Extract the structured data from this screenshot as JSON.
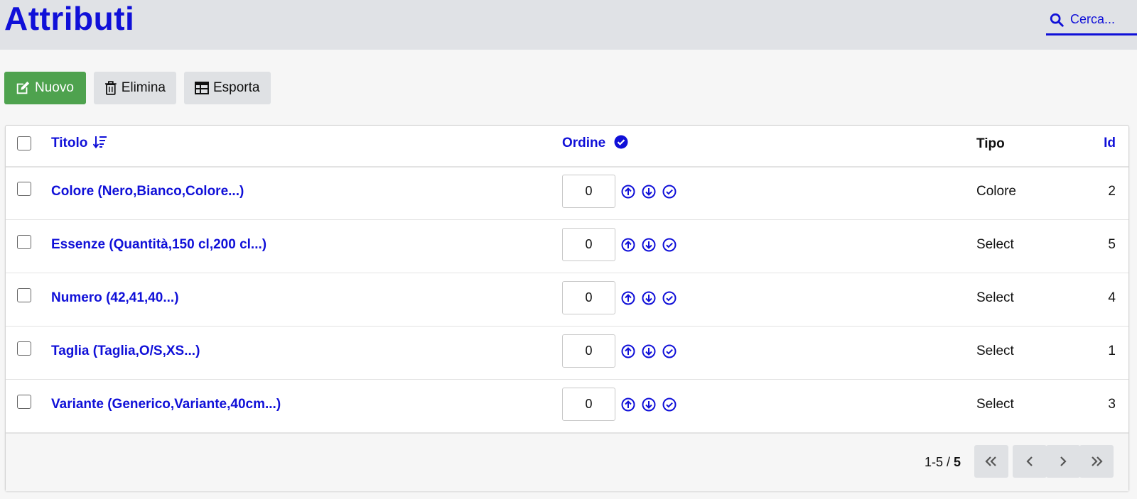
{
  "header": {
    "title": "Attributi",
    "search_label": "Cerca..."
  },
  "toolbar": {
    "new_label": "Nuovo",
    "delete_label": "Elimina",
    "export_label": "Esporta"
  },
  "table": {
    "columns": {
      "title": "Titolo",
      "order": "Ordine",
      "type": "Tipo",
      "id": "Id"
    },
    "rows": [
      {
        "title": "Colore (Nero,Bianco,Colore...)",
        "order": "0",
        "type": "Colore",
        "id": "2"
      },
      {
        "title": "Essenze (Quantità,150 cl,200 cl...)",
        "order": "0",
        "type": "Select",
        "id": "5"
      },
      {
        "title": "Numero (42,41,40...)",
        "order": "0",
        "type": "Select",
        "id": "4"
      },
      {
        "title": "Taglia (Taglia,O/S,XS...)",
        "order": "0",
        "type": "Select",
        "id": "1"
      },
      {
        "title": "Variante (Generico,Variante,40cm...)",
        "order": "0",
        "type": "Select",
        "id": "3"
      }
    ]
  },
  "pagination": {
    "range": "1-5 / ",
    "total": "5"
  },
  "colors": {
    "accent": "#1010d8",
    "new_button": "#4ea24e",
    "gray_button": "#dfe1e4",
    "header_bg": "#e0e2e6"
  },
  "icons": {
    "search": "search-icon",
    "new": "edit-icon",
    "delete": "trash-icon",
    "export": "table-icon",
    "sort": "sort-desc-icon",
    "order_header": "check-circle-filled-icon",
    "row_actions": [
      "arrow-up-circle-icon",
      "arrow-down-circle-icon",
      "check-circle-icon"
    ],
    "pagination": [
      "first-page-icon",
      "prev-page-icon",
      "next-page-icon",
      "last-page-icon"
    ]
  }
}
